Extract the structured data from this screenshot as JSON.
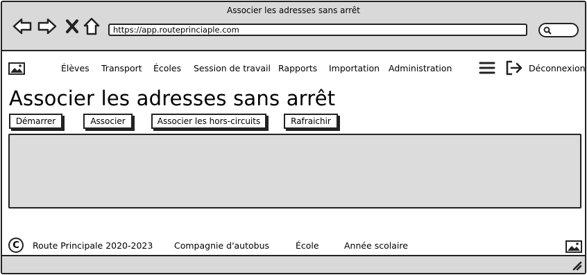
{
  "window": {
    "title": "Associer les adresses sans arrêt",
    "url": "https://app.routeprinciaple.com"
  },
  "nav": {
    "items": [
      "Élèves",
      "Transport",
      "Écoles",
      "Session de travail",
      "Rapports",
      "Importation",
      "Administration"
    ],
    "logout_label": "Déconnexion"
  },
  "page": {
    "title": "Associer les adresses sans arrêt"
  },
  "actions": {
    "start": "Démarrer",
    "associate": "Associer",
    "associate_off_route": "Associer les hors-circuits",
    "refresh": "Rafraichir"
  },
  "footer": {
    "copyright": "Route Principale 2020-2023",
    "links": [
      "Compagnie d'autobus",
      "École",
      "Année scolaire"
    ]
  },
  "icons": {
    "back": "back-arrow-icon",
    "forward": "forward-arrow-icon",
    "stop": "close-icon",
    "home": "home-icon",
    "search": "search-icon",
    "logo": "image-icon",
    "menu": "hamburger-menu-icon",
    "logout": "logout-icon",
    "copyright": "copyright-icon",
    "resize": "resize-grip-icon"
  },
  "colors": {
    "chrome": "#d9d9d9",
    "grid": "#dcdcdc",
    "border": "#222222"
  }
}
